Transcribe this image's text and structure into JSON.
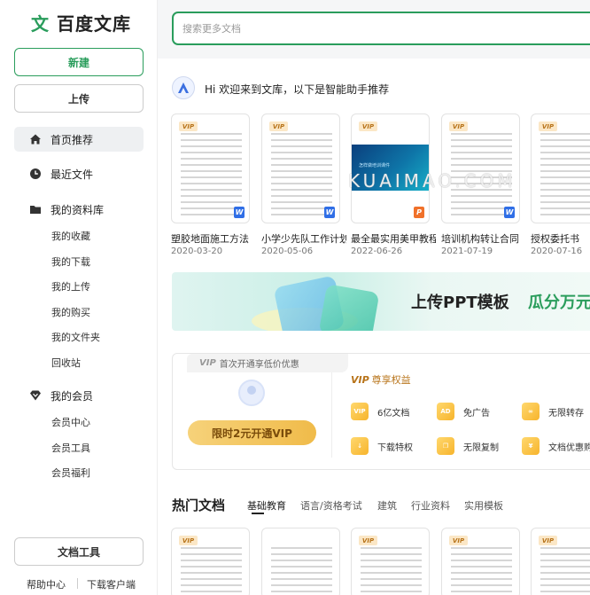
{
  "brand": {
    "logo_char": "文",
    "name": "百度文库"
  },
  "sidebar": {
    "new_label": "新建",
    "upload_label": "上传",
    "nav": [
      {
        "label": "首页推荐",
        "icon": "home-icon"
      },
      {
        "label": "最近文件",
        "icon": "clock-icon"
      },
      {
        "label": "我的资料库",
        "icon": "folder-icon"
      }
    ],
    "library_items": [
      "我的收藏",
      "我的下载",
      "我的上传",
      "我的购买",
      "我的文件夹",
      "回收站"
    ],
    "member_label": "我的会员",
    "member_items": [
      "会员中心",
      "会员工具",
      "会员福利"
    ],
    "tools_label": "文档工具",
    "footer": {
      "help": "帮助中心",
      "download": "下载客户端"
    }
  },
  "search": {
    "placeholder": "搜索更多文档"
  },
  "greeting": "Hi 欢迎来到文库，以下是智能助手推荐",
  "recommend": [
    {
      "title": "塑胶地面施工方法",
      "date": "2020-03-20",
      "type": "W"
    },
    {
      "title": "小学少先队工作计划",
      "date": "2020-05-06",
      "type": "W"
    },
    {
      "title": "最全最实用美甲教程",
      "date": "2022-06-26",
      "type": "P"
    },
    {
      "title": "培训机构转让合同",
      "date": "2021-07-19",
      "type": "W"
    },
    {
      "title": "授权委托书",
      "date": "2020-07-16",
      "type": ""
    }
  ],
  "vip_tag": "VIP",
  "ppt_cover_text": "怎样做培训课件 ",
  "watermark": "KUAIMAO.COM",
  "banner": {
    "text": "上传PPT模板",
    "accent": "瓜分万元"
  },
  "vip_offer": {
    "first_label": "首次开通享低价优惠",
    "button": "限时2元开通VIP",
    "privilege_title": "尊享权益",
    "privileges": [
      {
        "label": "6亿文档",
        "icon": "vip-docs-icon"
      },
      {
        "label": "免广告",
        "icon": "no-ad-icon"
      },
      {
        "label": "无限转存",
        "icon": "transfer-icon"
      },
      {
        "label": "下载特权",
        "icon": "download-icon"
      },
      {
        "label": "无限复制",
        "icon": "copy-icon"
      },
      {
        "label": "文档优惠购",
        "icon": "discount-icon"
      }
    ]
  },
  "hot": {
    "title": "热门文档",
    "tabs": [
      "基础教育",
      "语言/资格考试",
      "建筑",
      "行业资料",
      "实用模板"
    ]
  }
}
